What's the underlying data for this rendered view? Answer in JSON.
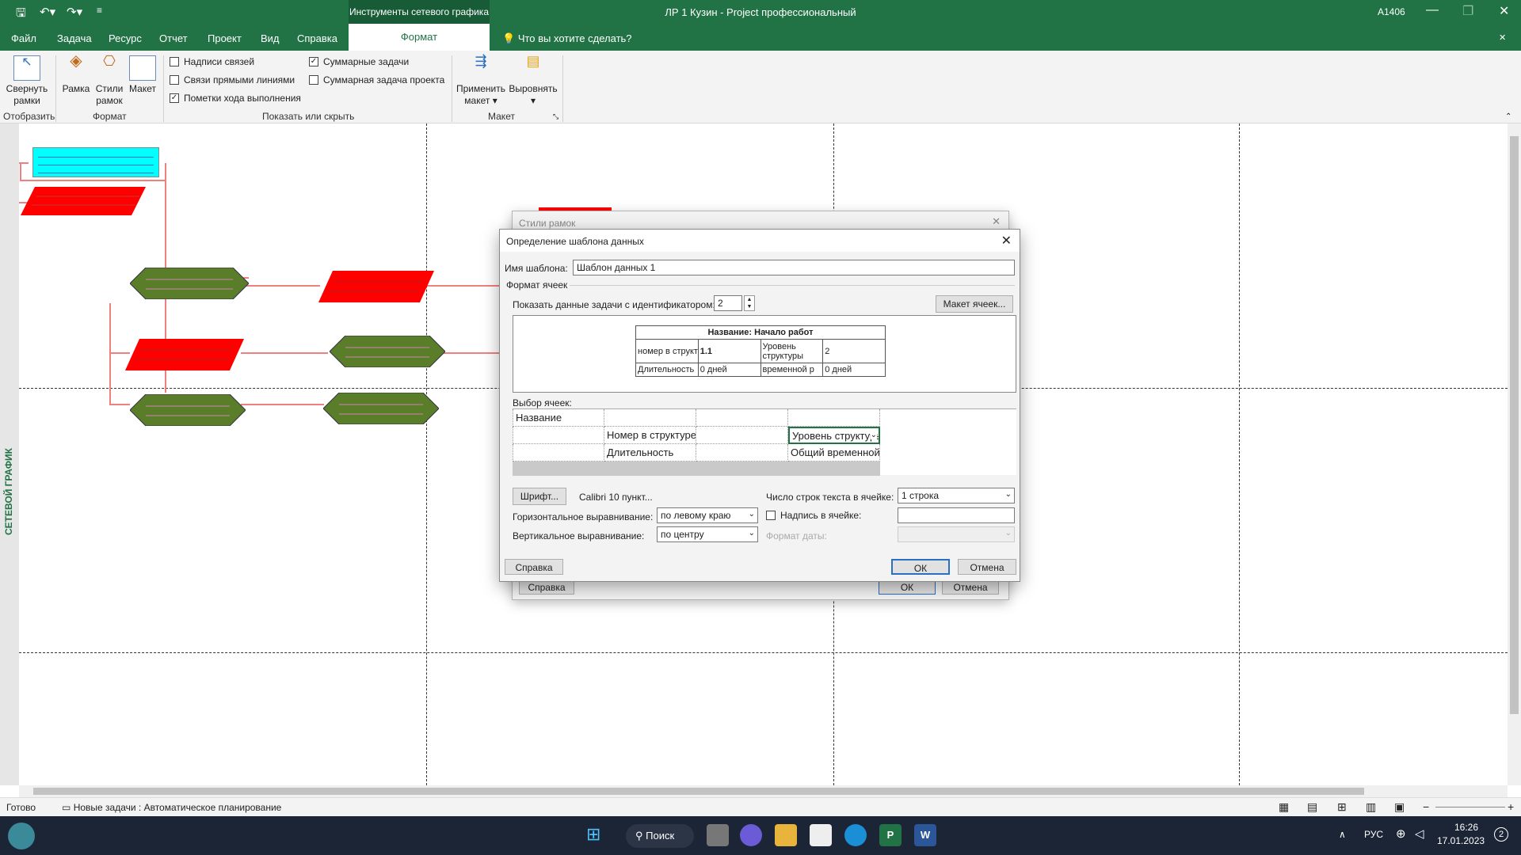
{
  "titlebar": {
    "tools_tab": "Инструменты сетевого графика",
    "title": "ЛР 1 Кузин  -  Project профессиональный",
    "user": "А1406"
  },
  "menu": [
    "Файл",
    "Задача",
    "Ресурс",
    "Отчет",
    "Проект",
    "Вид",
    "Справка"
  ],
  "menu_active": "Формат",
  "tell_me": "Что вы хотите сделать?",
  "ribbon": {
    "collapse": "Свернуть рамки",
    "show_group": "Отобразить",
    "frame": "Рамка",
    "frame_styles": "Стили рамок",
    "layout": "Макет",
    "format_group": "Формат",
    "cb_link_labels": "Надписи связей",
    "cb_straight_links": "Связи прямыми линиями",
    "cb_progress": "Пометки хода выполнения",
    "cb_summary": "Суммарные задачи",
    "cb_project_summary": "Суммарная задача проекта",
    "showhide_group": "Показать или скрыть",
    "apply_layout": "Применить макет",
    "align": "Выровнять",
    "layout_group": "Макет"
  },
  "side_label": "СЕТЕВОЙ ГРАФИК",
  "back_dialog": {
    "title": "Стили рамок",
    "help": "Справка",
    "ok": "ОК",
    "cancel": "Отмена"
  },
  "dialog": {
    "title": "Определение шаблона данных",
    "template_name_label": "Имя шаблона:",
    "template_name_value": "Шаблон данных 1",
    "cell_format_label": "Формат ячеек",
    "show_task_label": "Показать данные задачи с идентификатором:",
    "task_id_value": "2",
    "cell_layout_button": "Макет ячеек...",
    "preview": {
      "title": "Название: Начало работ",
      "r1c1": "номер в структ",
      "r1c2": "1.1",
      "r1c3": "Уровень структуры",
      "r1c4": "2",
      "r2c1": "Длительность",
      "r2c2": "0 дней",
      "r2c3": "временной р",
      "r2c4": "0 дней"
    },
    "cell_select_label": "Выбор ячеек:",
    "grid": {
      "name": "Название",
      "wbs": "Номер в структуре",
      "level": "Уровень структуры",
      "duration": "Длительность",
      "total_slack": "Общий временной"
    },
    "font_button": "Шрифт...",
    "font_value": "Calibri 10 пункт...",
    "lines_label": "Число строк текста в ячейке:",
    "lines_value": "1 строка",
    "halign_label": "Горизонтальное выравнивание:",
    "halign_value": "по левому краю",
    "label_in_cell": "Надпись в ячейке:",
    "valign_label": "Вертикальное выравнивание:",
    "valign_value": "по центру",
    "date_format_label": "Формат даты:",
    "help": "Справка",
    "ok": "ОК",
    "cancel": "Отмена"
  },
  "status": {
    "ready": "Готово",
    "new_tasks": "Новые задачи : Автоматическое планирование"
  },
  "taskbar": {
    "search": "Поиск",
    "lang": "РУС",
    "time": "16:26",
    "date": "17.01.2023",
    "badge": "2"
  }
}
